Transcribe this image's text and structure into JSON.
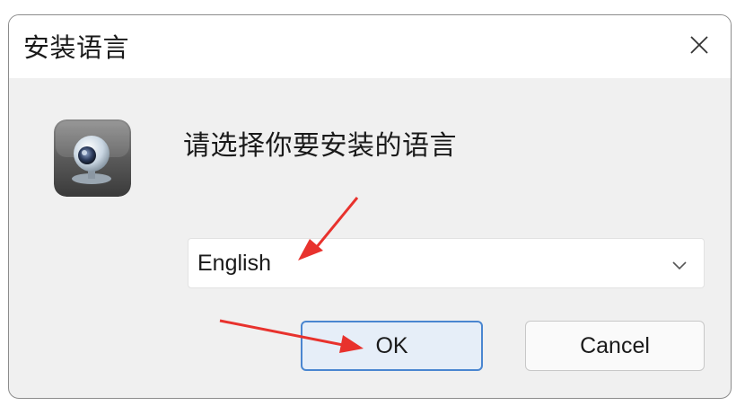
{
  "dialog": {
    "title": "安装语言",
    "close_icon": "close-icon",
    "app_icon": "webcam-icon",
    "prompt": "请选择你要安装的语言",
    "language_select": {
      "selected": "English",
      "dropdown_icon": "chevron-down-icon"
    },
    "buttons": {
      "ok_label": "OK",
      "cancel_label": "Cancel"
    }
  },
  "annotations": {
    "arrow_color": "#e8322d",
    "arrows": [
      "arrow-to-language-select",
      "arrow-to-ok-button"
    ]
  },
  "colors": {
    "dialog_bg": "#f0f0f0",
    "titlebar_bg": "#ffffff",
    "ok_border": "#4a86d0",
    "ok_bg": "#e6eef8"
  }
}
